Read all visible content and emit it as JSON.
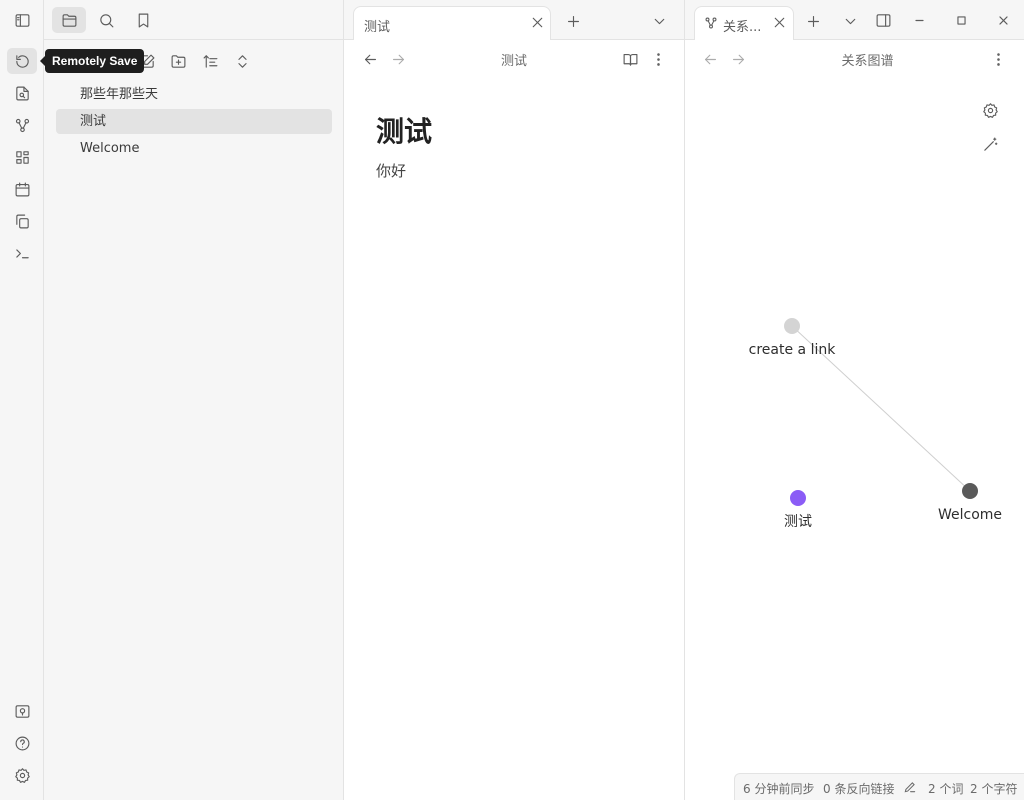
{
  "tooltip": {
    "text": "Remotely Save"
  },
  "files": [
    {
      "name": "那些年那些天",
      "active": false
    },
    {
      "name": "测试",
      "active": true
    },
    {
      "name": "Welcome",
      "active": false
    }
  ],
  "left_tab": {
    "title": "测试"
  },
  "right_tab": {
    "title": "关系..."
  },
  "note_pane": {
    "header_title": "测试",
    "heading": "测试",
    "body": "你好"
  },
  "graph_pane": {
    "header_title": "关系图谱",
    "nodes": [
      {
        "label": "create a link",
        "color": "#d4d4d4"
      },
      {
        "label": "Welcome",
        "color": "#5a5a5a"
      },
      {
        "label": "测试",
        "color": "#8b5cf6"
      }
    ]
  },
  "status": {
    "sync": "6 分钟前同步",
    "backlinks": "0 条反向链接",
    "words": "2 个词",
    "chars": "2 个字符"
  },
  "icons": {
    "ribbon_top": [
      "remotely-save-icon",
      "file-search-icon",
      "graph-icon",
      "dashboard-icon",
      "calendar-icon",
      "copy-icon",
      "terminal-icon"
    ],
    "ribbon_bottom": [
      "vault-icon",
      "help-icon",
      "settings-icon"
    ]
  },
  "colors": {
    "accent": "#8b5cf6",
    "tooltip_bg": "#1e1e1e"
  }
}
